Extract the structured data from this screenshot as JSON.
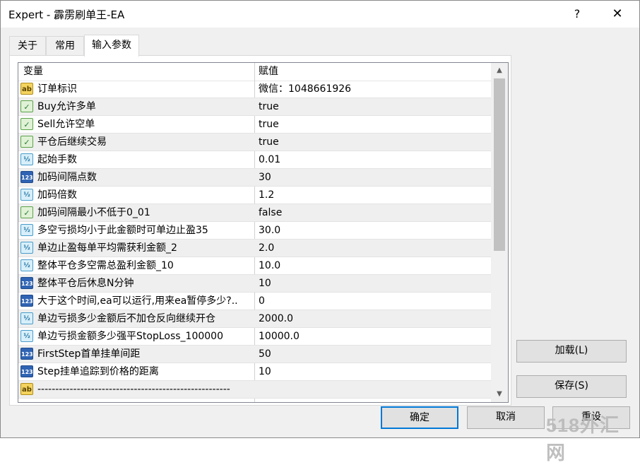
{
  "window": {
    "title": "Expert - 霹雳刷单王-EA",
    "help": "?",
    "close": "✕"
  },
  "tabs": [
    "关于",
    "常用",
    "输入参数"
  ],
  "grid": {
    "columns": [
      "变量",
      "赋值"
    ],
    "rows": [
      {
        "type": "ab",
        "name": "订单标识",
        "value": "微信：1048661926"
      },
      {
        "type": "bool",
        "name": "Buy允许多单",
        "value": "true"
      },
      {
        "type": "bool",
        "name": "Sell允许空单",
        "value": "true"
      },
      {
        "type": "bool",
        "name": "平仓后继续交易",
        "value": "true"
      },
      {
        "type": "dbl",
        "name": "起始手数",
        "value": "0.01"
      },
      {
        "type": "int",
        "name": "加码间隔点数",
        "value": "30"
      },
      {
        "type": "dbl",
        "name": "加码倍数",
        "value": "1.2"
      },
      {
        "type": "bool",
        "name": "加码间隔最小不低于0_01",
        "value": "false"
      },
      {
        "type": "dbl",
        "name": "多空亏损均小于此金额时可单边止盈35",
        "value": "30.0"
      },
      {
        "type": "dbl",
        "name": "单边止盈每单平均需获利金额_2",
        "value": "2.0"
      },
      {
        "type": "dbl",
        "name": "整体平仓多空需总盈利金额_10",
        "value": "10.0"
      },
      {
        "type": "int",
        "name": "整体平仓后休息N分钟",
        "value": "10"
      },
      {
        "type": "int",
        "name": "大于这个时间,ea可以运行,用来ea暂停多少?..",
        "value": "0"
      },
      {
        "type": "dbl",
        "name": "单边亏损多少金额后不加仓反向继续开仓",
        "value": "2000.0"
      },
      {
        "type": "dbl",
        "name": "单边亏损金额多少强平StopLoss_100000",
        "value": "10000.0"
      },
      {
        "type": "int",
        "name": "FirstStep首单挂单间距",
        "value": "50"
      },
      {
        "type": "int",
        "name": "Step挂单追踪到价格的距离",
        "value": "10"
      },
      {
        "type": "ab",
        "name": "------------------------------------------------------",
        "value": ""
      }
    ],
    "scroll_up": "▲",
    "scroll_down": "▼"
  },
  "icons": {
    "ab": "ab",
    "bool": "✓",
    "dbl": "½",
    "int": "123"
  },
  "buttons": {
    "load": "加载(L)",
    "save": "保存(S)",
    "ok": "确定",
    "cancel": "取消",
    "reset": "重设"
  },
  "watermark": "518外汇网"
}
